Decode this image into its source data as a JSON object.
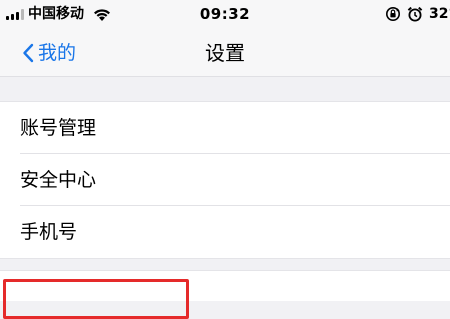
{
  "status_bar": {
    "carrier": "中国移动",
    "time": "09:32",
    "battery": "32°",
    "icons": [
      "signal-icon",
      "wifi-icon",
      "rotation-lock-icon",
      "alarm-icon"
    ]
  },
  "nav": {
    "back_label": "我的",
    "title": "设置"
  },
  "settings": {
    "items": [
      {
        "label": "账号管理"
      },
      {
        "label": "安全中心"
      },
      {
        "label": "手机号"
      }
    ]
  },
  "colors": {
    "accent": "#1a76e8",
    "highlight": "#e52a2a",
    "background": "#f1f1f4"
  }
}
